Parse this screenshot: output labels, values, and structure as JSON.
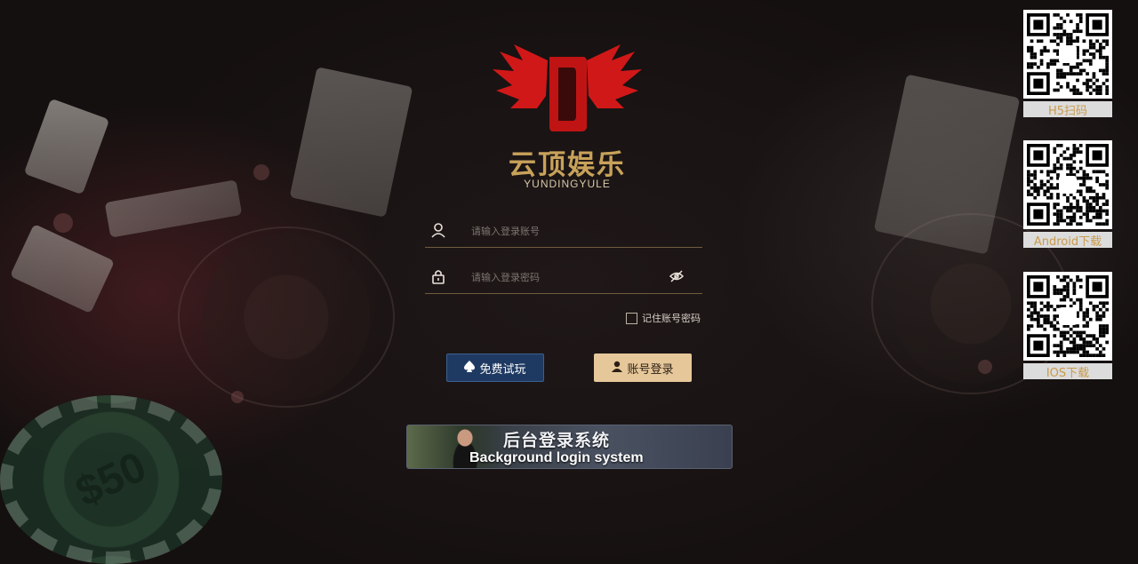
{
  "brand": {
    "name_cn": "云顶娱乐",
    "name_en": "YUNDINGYULE",
    "accent": "#c8a25a",
    "logo_red": "#d01818"
  },
  "login": {
    "username_placeholder": "请输入登录账号",
    "password_placeholder": "请输入登录密码",
    "remember_label": "记住账号密码",
    "remember_checked": false,
    "trial_button": "免费试玩",
    "login_button": "账号登录"
  },
  "banner": {
    "title_cn": "后台登录系统",
    "title_en": "Background login system"
  },
  "qr_codes": [
    {
      "label": "H5扫码",
      "icon": "qr-code-icon"
    },
    {
      "label": "Android下载",
      "icon": "qr-code-icon"
    },
    {
      "label": "IOS下载",
      "icon": "qr-code-icon"
    }
  ],
  "background": {
    "chip_text": "$50"
  },
  "colors": {
    "trial_button_bg": "#1f3a62",
    "login_button_bg": "#e6c79a",
    "qr_label_text": "#c99a4c"
  }
}
